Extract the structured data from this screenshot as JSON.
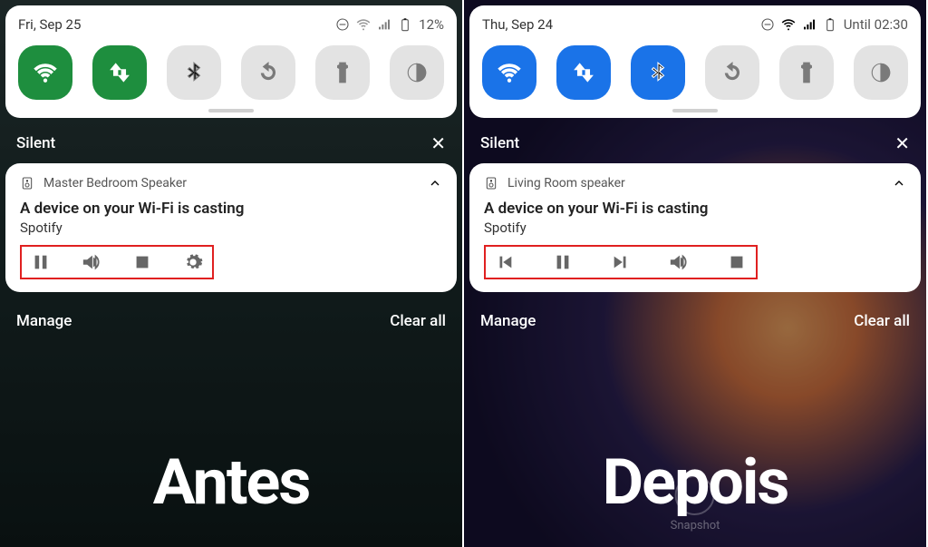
{
  "left": {
    "date": "Fri, Sep 25",
    "battery": "12%",
    "section": "Silent",
    "speaker": "Master Bedroom Speaker",
    "casting": "A device on your Wi-Fi is casting",
    "app": "Spotify",
    "manage": "Manage",
    "clear": "Clear all",
    "hero": "Antes",
    "toggles": [
      {
        "name": "wifi",
        "state": "on-green"
      },
      {
        "name": "data",
        "state": "on-green"
      },
      {
        "name": "bluetooth",
        "state": "off"
      },
      {
        "name": "rotate",
        "state": "off"
      },
      {
        "name": "flashlight",
        "state": "off"
      },
      {
        "name": "darkmode",
        "state": "off"
      }
    ],
    "controls": [
      "pause",
      "volume",
      "stop",
      "settings"
    ]
  },
  "right": {
    "date": "Thu, Sep 24",
    "battery": "Until 02:30",
    "section": "Silent",
    "speaker": "Living Room speaker",
    "casting": "A device on your Wi-Fi is casting",
    "app": "Spotify",
    "manage": "Manage",
    "clear": "Clear all",
    "hero": "Depois",
    "snapshot": "Snapshot",
    "toggles": [
      {
        "name": "wifi",
        "state": "on-blue"
      },
      {
        "name": "data",
        "state": "on-blue"
      },
      {
        "name": "bluetooth",
        "state": "on-blue"
      },
      {
        "name": "rotate",
        "state": "off"
      },
      {
        "name": "flashlight",
        "state": "off"
      },
      {
        "name": "darkmode",
        "state": "off"
      }
    ],
    "controls": [
      "prev",
      "pause",
      "next",
      "volume",
      "stop"
    ]
  }
}
